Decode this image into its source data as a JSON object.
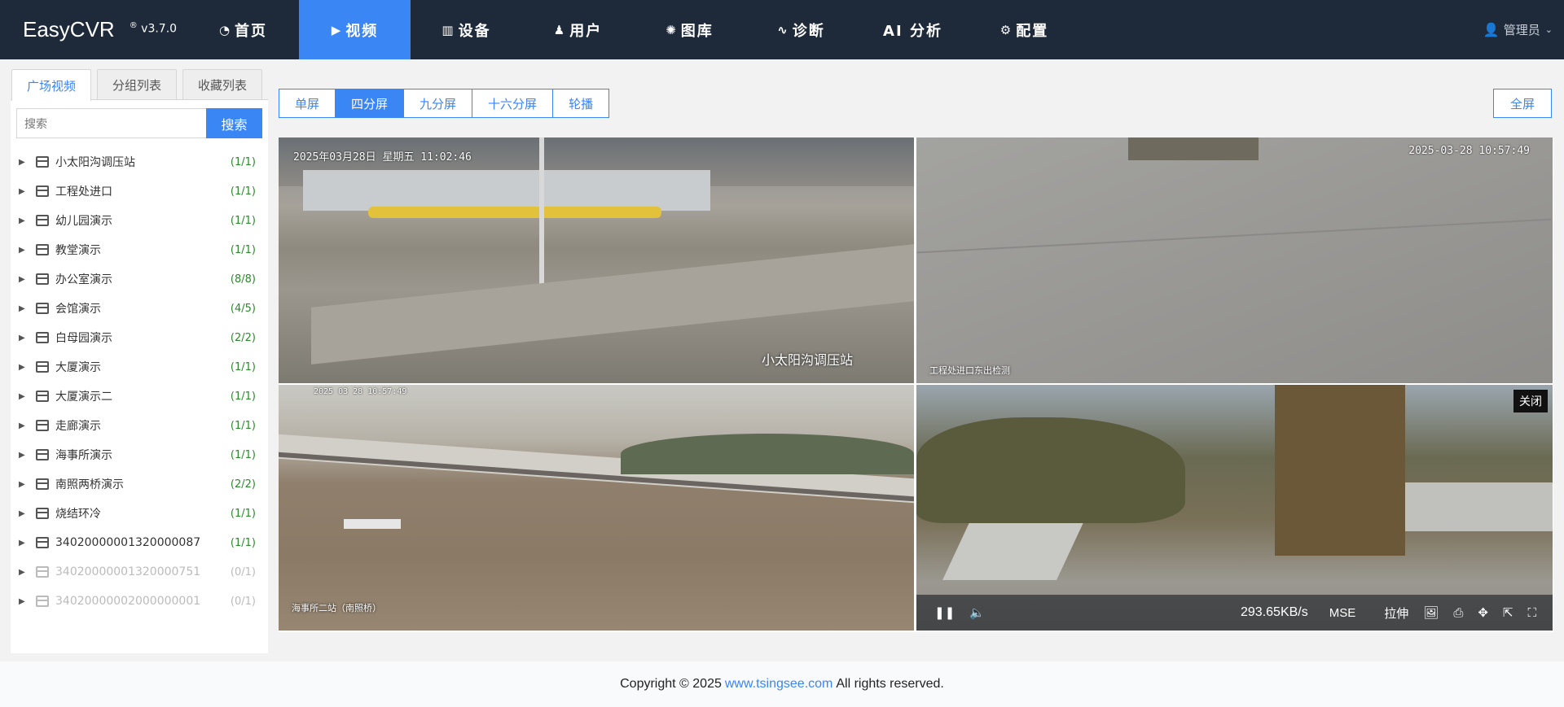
{
  "header": {
    "logo": "EasyCVR",
    "version_mark": "®",
    "version": "v3.7.0",
    "nav": [
      {
        "label": "首页",
        "icon": "dashboard-icon"
      },
      {
        "label": "视频",
        "icon": "play-circle-icon",
        "active": true
      },
      {
        "label": "设备",
        "icon": "barcode-icon"
      },
      {
        "label": "用户",
        "icon": "user-icon"
      },
      {
        "label": "图库",
        "icon": "gallery-icon"
      },
      {
        "label": "诊断",
        "icon": "pulse-icon"
      },
      {
        "label": "AI 分析",
        "icon": ""
      },
      {
        "label": "配置",
        "icon": "gear-icon"
      }
    ],
    "user": "管理员"
  },
  "sidebar": {
    "tabs": [
      "广场视频",
      "分组列表",
      "收藏列表"
    ],
    "search_placeholder": "搜索",
    "search_button": "搜索",
    "items": [
      {
        "name": "小太阳沟调压站",
        "count": "(1/1)"
      },
      {
        "name": "工程处进口",
        "count": "(1/1)"
      },
      {
        "name": "幼儿园演示",
        "count": "(1/1)"
      },
      {
        "name": "教堂演示",
        "count": "(1/1)"
      },
      {
        "name": "办公室演示",
        "count": "(8/8)"
      },
      {
        "name": "会馆演示",
        "count": "(4/5)"
      },
      {
        "name": "白母园演示",
        "count": "(2/2)"
      },
      {
        "name": "大厦演示",
        "count": "(1/1)"
      },
      {
        "name": "大厦演示二",
        "count": "(1/1)"
      },
      {
        "name": "走廊演示",
        "count": "(1/1)"
      },
      {
        "name": "海事所演示",
        "count": "(1/1)"
      },
      {
        "name": "南照两桥演示",
        "count": "(2/2)"
      },
      {
        "name": "烧结环冷",
        "count": "(1/1)"
      },
      {
        "name": "34020000001320000087",
        "count": "(1/1)"
      },
      {
        "name": "34020000001320000751",
        "count": "(0/1)",
        "offline": true
      },
      {
        "name": "34020000002000000001",
        "count": "(0/1)",
        "offline": true
      }
    ]
  },
  "toolbar": {
    "modes": [
      "单屏",
      "四分屏",
      "九分屏",
      "十六分屏",
      "轮播"
    ],
    "active_mode": "四分屏",
    "fullscreen": "全屏"
  },
  "cameras": [
    {
      "timestamp": "2025年03月28日 星期五 11:02:46",
      "label": "小太阳沟调压站"
    },
    {
      "timestamp": "2025-03-28 10:57:49",
      "label": "工程处进口东出检测"
    },
    {
      "timestamp": "2025 03 28 10:57:49",
      "label": "海事所二站（南照桥）"
    },
    {
      "timestamp": "",
      "label": ""
    }
  ],
  "player": {
    "close": "关闭",
    "bitrate": "293.65KB/s",
    "mode": "MSE",
    "stretch": "拉伸"
  },
  "footer": {
    "prefix": "Copyright © 2025",
    "link": "www.tsingsee.com",
    "suffix": "All rights reserved."
  }
}
